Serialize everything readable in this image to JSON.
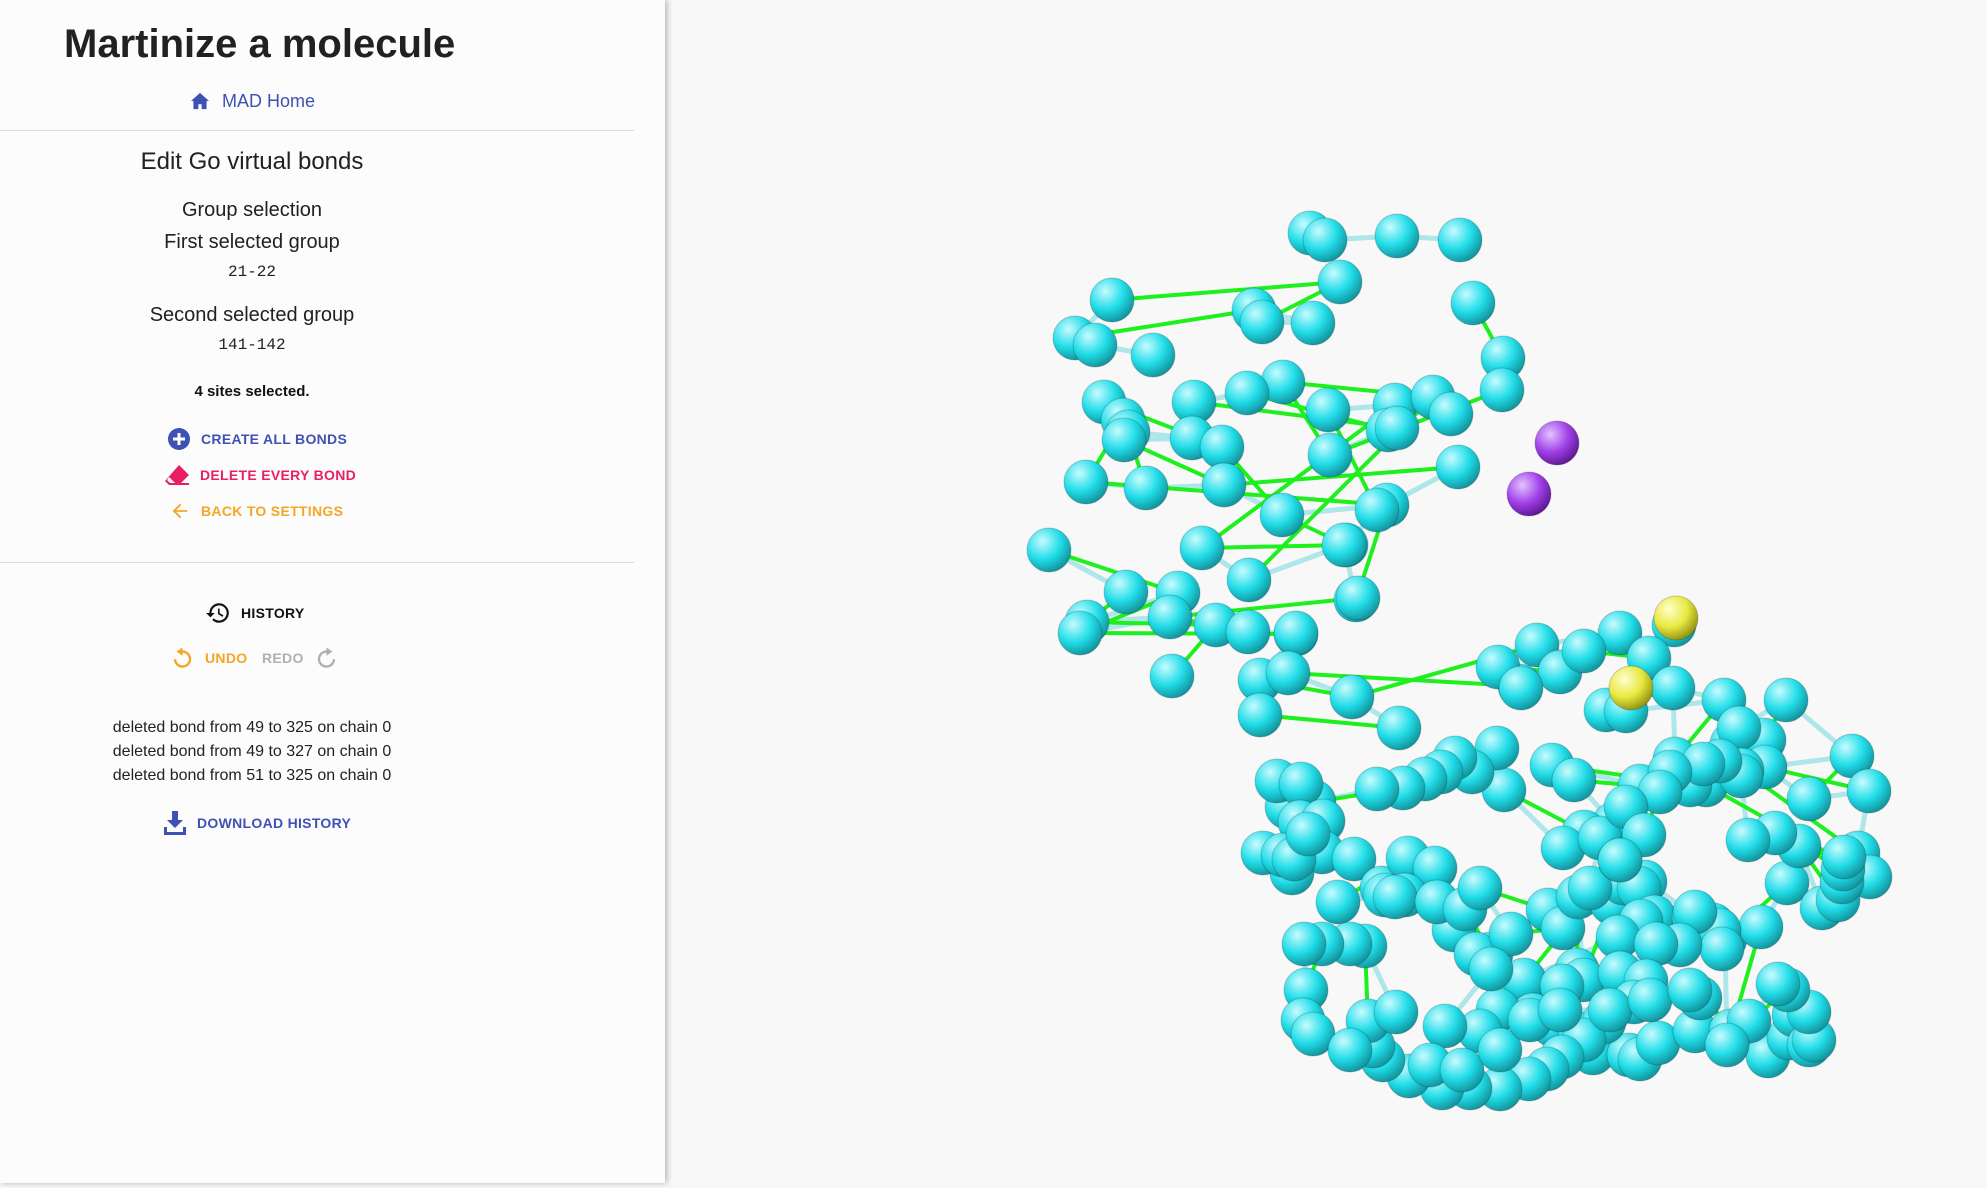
{
  "page": {
    "title": "Martinize a molecule",
    "home_link": "MAD Home"
  },
  "editor": {
    "section_title": "Edit Go virtual bonds",
    "group_selection_label": "Group selection",
    "first_group_label": "First selected group",
    "first_group_value": "21-22",
    "second_group_label": "Second selected group",
    "second_group_value": "141-142",
    "sites_selected": "4 sites selected.",
    "actions": {
      "create_all": "CREATE ALL BONDS",
      "delete_every": "DELETE EVERY BOND",
      "back": "BACK TO SETTINGS"
    }
  },
  "history": {
    "label": "HISTORY",
    "undo": "UNDO",
    "redo": "REDO",
    "entries": [
      "deleted bond from 49 to 325 on chain 0",
      "deleted bond from 49 to 327 on chain 0",
      "deleted bond from 51 to 325 on chain 0"
    ],
    "download": "DOWNLOAD HISTORY"
  },
  "colors": {
    "primary": "#3f51b5",
    "danger": "#e91e63",
    "warning": "#f5a623",
    "disabled": "#b0b0b0",
    "bead": "#21dde8",
    "go_bond": "#1ef01e",
    "backbone_bond": "#aee6ea",
    "selected_group_1": "#a040e8",
    "selected_group_2": "#e8e840"
  },
  "viewer": {
    "icons": [
      "bead-icon",
      "selected-bead-icon",
      "go-bond-icon",
      "backbone-bond-icon"
    ]
  }
}
